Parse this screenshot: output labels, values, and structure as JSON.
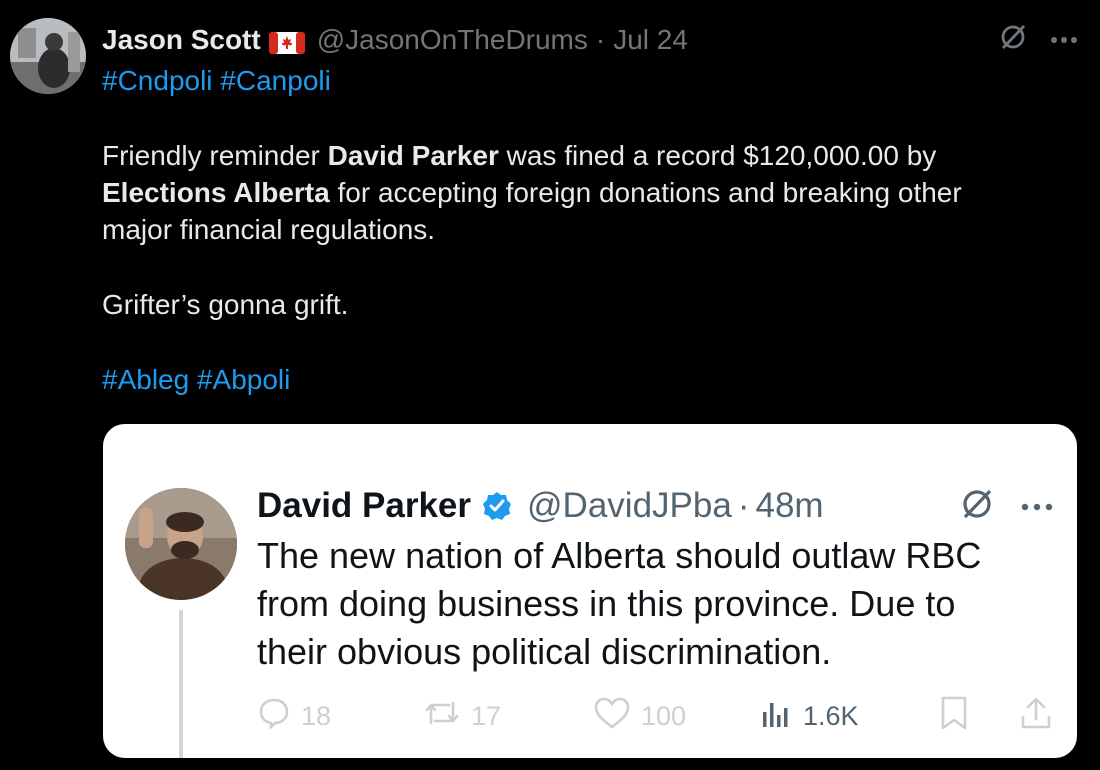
{
  "tweet": {
    "author_name": "Jason Scott",
    "author_handle": "@JasonOnTheDrums",
    "separator": "·",
    "date": "Jul 24",
    "hashtags_top": "#Cndpoli #Canpoli",
    "line1_a": "Friendly reminder ",
    "line1_bold": "David Parker",
    "line1_b": " was fined a record $120,000.00 by",
    "line2_bold": "Elections Alberta",
    "line2_b": " for accepting foreign donations and breaking other",
    "line3": "major financial regulations.",
    "line4": "Grifter’s gonna grift.",
    "hashtags_bottom": "#Ableg #Abpoli"
  },
  "quoted": {
    "author_name": "David Parker",
    "author_handle": "@DavidJPba",
    "separator": "·",
    "time": "48m",
    "text_line1": "The new nation of Alberta should outlaw RBC",
    "text_line2": "from doing business in this province. Due to",
    "text_line3": "their obvious political discrimination.",
    "replies": "18",
    "reposts": "17",
    "likes": "100",
    "views": "1.6K"
  },
  "icons": {
    "grok": "grok-icon",
    "more": "more-icon",
    "reply": "reply-icon",
    "repost": "repost-icon",
    "like": "like-icon",
    "views": "views-icon",
    "bookmark": "bookmark-icon",
    "share": "share-icon",
    "flag": "canada-flag-icon",
    "verified": "verified-badge-icon"
  },
  "colors": {
    "link": "#1d9bf0",
    "background": "#000000",
    "card": "#ffffff"
  }
}
